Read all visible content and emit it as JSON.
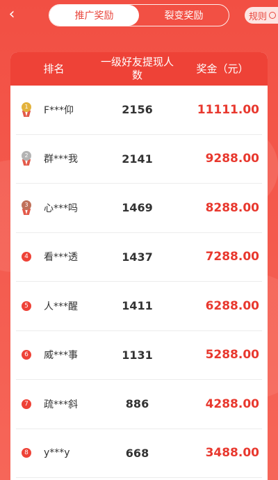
{
  "header": {
    "back_glyph": "‹",
    "tabs": [
      {
        "label": "推广奖励",
        "active": true
      },
      {
        "label": "裂变奖励",
        "active": false
      }
    ],
    "rules_label": "规则"
  },
  "table": {
    "columns": [
      "排名",
      "一级好友提现人数",
      "奖金（元）"
    ],
    "rows": [
      {
        "rank": "1",
        "name": "F***仰",
        "count": "2156",
        "bonus": "11111.00"
      },
      {
        "rank": "2",
        "name": "群***我",
        "count": "2141",
        "bonus": "9288.00"
      },
      {
        "rank": "3",
        "name": "心***吗",
        "count": "1469",
        "bonus": "8288.00"
      },
      {
        "rank": "4",
        "name": "看***透",
        "count": "1437",
        "bonus": "7288.00"
      },
      {
        "rank": "5",
        "name": "人***醒",
        "count": "1411",
        "bonus": "6288.00"
      },
      {
        "rank": "6",
        "name": "威***事",
        "count": "1131",
        "bonus": "5288.00"
      },
      {
        "rank": "7",
        "name": "疏***斜",
        "count": "886",
        "bonus": "4288.00"
      },
      {
        "rank": "8",
        "name": "y***y",
        "count": "668",
        "bonus": "3488.00"
      }
    ]
  },
  "colors": {
    "accent": "#ee4237",
    "gold": "#e3b23c",
    "silver": "#b4b4b4",
    "bronze": "#c0715a"
  }
}
